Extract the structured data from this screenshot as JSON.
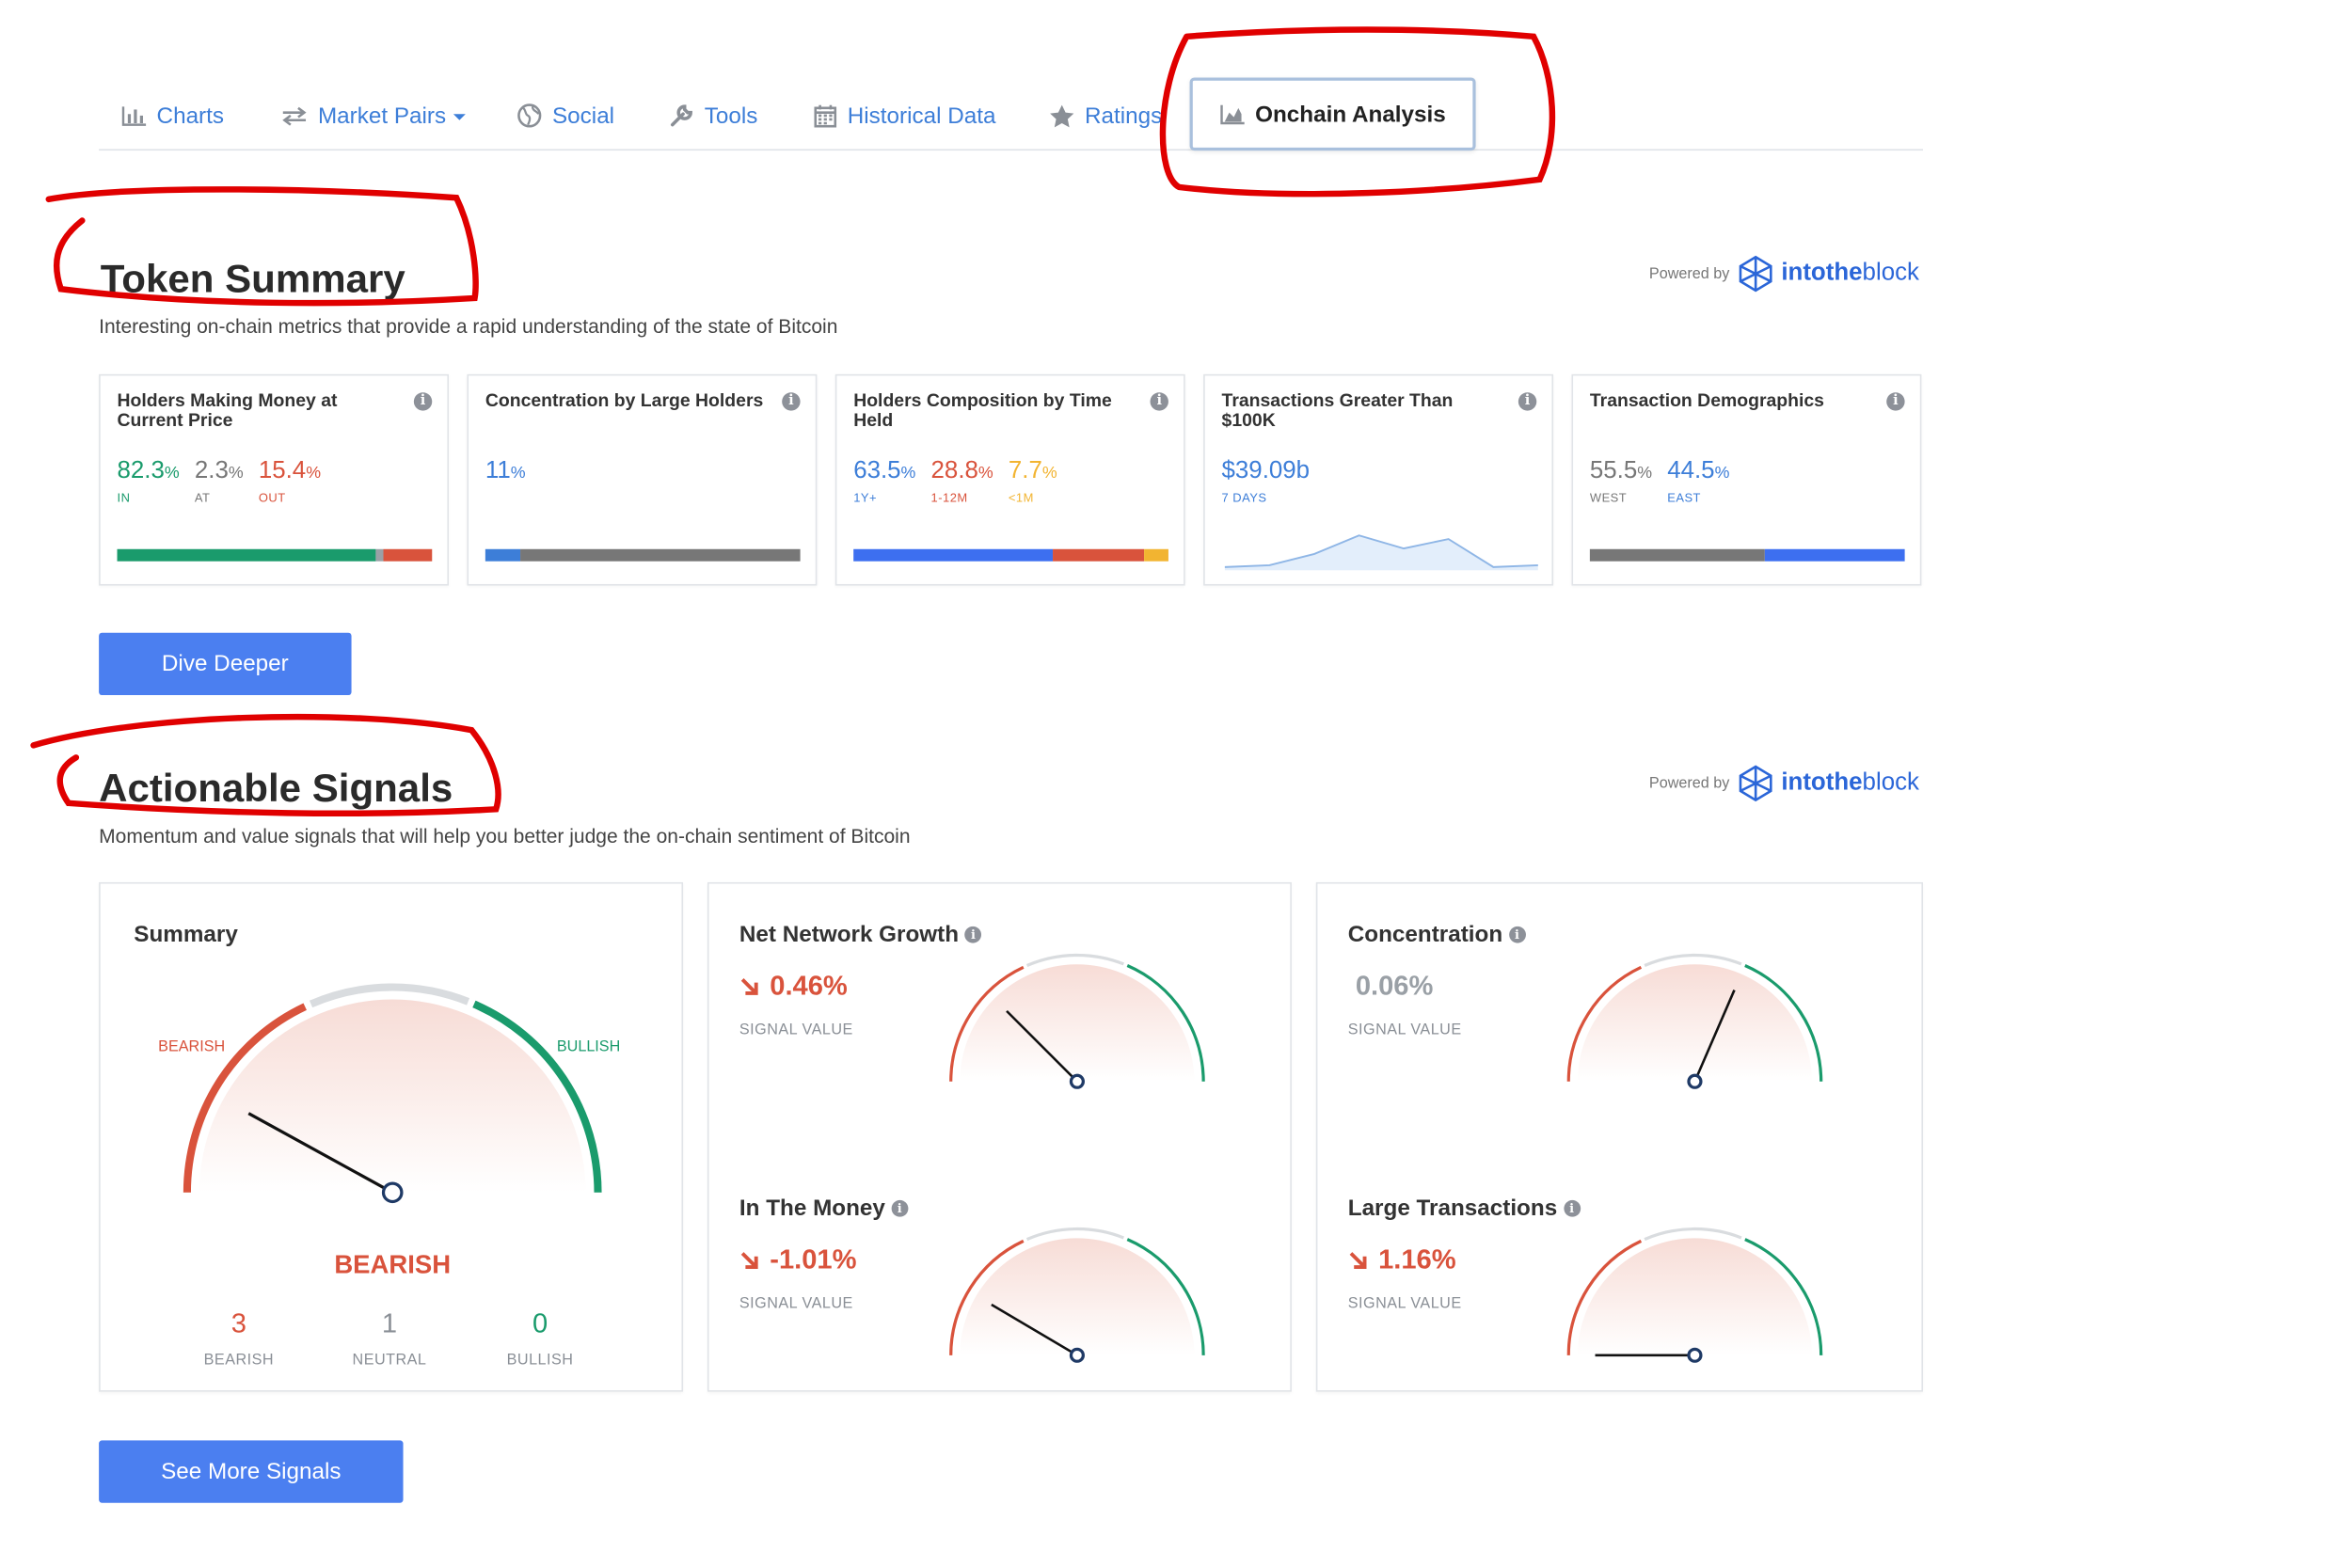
{
  "tabs": [
    {
      "label": "Charts",
      "icon": "bar-chart-icon"
    },
    {
      "label": "Market Pairs",
      "icon": "exchange-arrows-icon"
    },
    {
      "label": "Social",
      "icon": "globe-icon"
    },
    {
      "label": "Tools",
      "icon": "wrench-icon"
    },
    {
      "label": "Historical Data",
      "icon": "calendar-icon"
    },
    {
      "label": "Ratings",
      "icon": "star-icon"
    },
    {
      "label": "Onchain Analysis",
      "icon": "area-chart-icon",
      "active": true
    }
  ],
  "powered_by": {
    "label": "Powered by",
    "brand_bold": "intothe",
    "brand_rest": "block"
  },
  "token_summary": {
    "title": "Token Summary",
    "subtitle": "Interesting on-chain metrics that provide a rapid understanding of the state of Bitcoin",
    "cards": [
      {
        "title": "Holders Making Money at Current Price",
        "values": [
          {
            "num": "82.3",
            "unit": "%",
            "cap": "IN",
            "color": "#1a9b6c"
          },
          {
            "num": "2.3",
            "unit": "%",
            "cap": "AT",
            "color": "#777777"
          },
          {
            "num": "15.4",
            "unit": "%",
            "cap": "OUT",
            "color": "#d9533c"
          }
        ],
        "bar": [
          {
            "pct": 82.3,
            "color": "#1a9b6c"
          },
          {
            "pct": 2.3,
            "color": "#9aa0a6"
          },
          {
            "pct": 15.4,
            "color": "#d9533c"
          }
        ]
      },
      {
        "title": "Concentration by Large Holders",
        "values": [
          {
            "num": "11",
            "unit": "%",
            "cap": "",
            "color": "#3d7ed8"
          }
        ],
        "bar": [
          {
            "pct": 11,
            "color": "#3d7ed8"
          },
          {
            "pct": 89,
            "color": "#777777"
          }
        ]
      },
      {
        "title": "Holders Composition by Time Held",
        "values": [
          {
            "num": "63.5",
            "unit": "%",
            "cap": "1Y+",
            "color": "#3d7ed8"
          },
          {
            "num": "28.8",
            "unit": "%",
            "cap": "1-12M",
            "color": "#d9533c"
          },
          {
            "num": "7.7",
            "unit": "%",
            "cap": "<1M",
            "color": "#f2b431"
          }
        ],
        "bar": [
          {
            "pct": 63.5,
            "color": "#3d6ff0"
          },
          {
            "pct": 28.8,
            "color": "#d9533c"
          },
          {
            "pct": 7.7,
            "color": "#f2b431"
          }
        ]
      },
      {
        "title": "Transactions Greater Than $100K",
        "values": [
          {
            "num": "$39.09b",
            "unit": "",
            "cap": "7 DAYS",
            "color": "#3d7ed8"
          }
        ],
        "sparkline": [
          1,
          2,
          8,
          18,
          11,
          16,
          1,
          2
        ]
      },
      {
        "title": "Transaction Demographics",
        "values": [
          {
            "num": "55.5",
            "unit": "%",
            "cap": "WEST",
            "color": "#777777"
          },
          {
            "num": "44.5",
            "unit": "%",
            "cap": "EAST",
            "color": "#3d7ed8"
          }
        ],
        "bar": [
          {
            "pct": 55.5,
            "color": "#777777"
          },
          {
            "pct": 44.5,
            "color": "#3d6ff0"
          }
        ]
      }
    ],
    "button": "Dive Deeper"
  },
  "signals": {
    "title": "Actionable Signals",
    "subtitle": "Momentum and value signals that will help you better judge the on-chain sentiment of Bitcoin",
    "summary": {
      "title": "Summary",
      "bearish_label": "BEARISH",
      "bullish_label": "BULLISH",
      "result": "BEARISH",
      "needle_value": 0.16,
      "counts": [
        {
          "n": "3",
          "label": "BEARISH",
          "color": "#d9533c"
        },
        {
          "n": "1",
          "label": "NEUTRAL",
          "color": "#8a8f96"
        },
        {
          "n": "0",
          "label": "BULLISH",
          "color": "#1a9b6c"
        }
      ]
    },
    "items": [
      {
        "title": "Net Network Growth",
        "value": "0.46%",
        "trend": "down",
        "caption": "SIGNAL VALUE",
        "needle_value": 0.25,
        "color": "#d9533c"
      },
      {
        "title": "Concentration",
        "value": "0.06%",
        "trend": "neutral",
        "caption": "SIGNAL VALUE",
        "needle_value": 0.63,
        "color": "#9aa0a6"
      },
      {
        "title": "In The Money",
        "value": "-1.01%",
        "trend": "down",
        "caption": "SIGNAL VALUE",
        "needle_value": 0.17,
        "color": "#d9533c"
      },
      {
        "title": "Large Transactions",
        "value": "1.16%",
        "trend": "down",
        "caption": "SIGNAL VALUE",
        "needle_value": 0.0,
        "color": "#d9533c"
      }
    ],
    "button": "See More Signals"
  },
  "colors": {
    "accent": "#4b7ff0",
    "bearish": "#d9533c",
    "bullish": "#1a9b6c",
    "annotation": "#e00000"
  }
}
